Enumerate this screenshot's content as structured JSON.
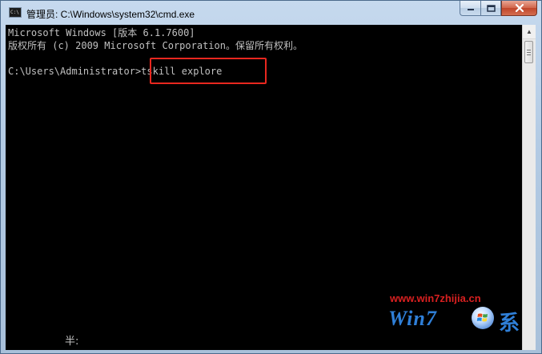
{
  "window": {
    "title": "管理员: C:\\Windows\\system32\\cmd.exe",
    "icon": "cmd-icon",
    "icon_text": "C:\\"
  },
  "controls": {
    "minimize_icon": "minimize-icon",
    "maximize_icon": "maximize-icon",
    "close_icon": "close-icon",
    "minimize_glyph": "▁",
    "maximize_glyph": "□",
    "close_glyph": "✕"
  },
  "console": {
    "line1": "Microsoft Windows [版本 6.1.7600]",
    "line2": "版权所有 (c) 2009 Microsoft Corporation。保留所有权利。",
    "prompt": "C:\\Users\\Administrator>",
    "command": "tskill explore",
    "ime_status": "半:"
  },
  "watermark": {
    "url": "www.win7zhijia.cn",
    "logo_text": "Win7",
    "glyph": "系"
  },
  "colors": {
    "console_bg": "#000000",
    "console_text": "#c0c0c0",
    "highlight_border": "#e8271f",
    "watermark_url": "#d92020",
    "watermark_logo": "#2f7fd8"
  },
  "scrollbar": {
    "up_arrow": "▲"
  }
}
